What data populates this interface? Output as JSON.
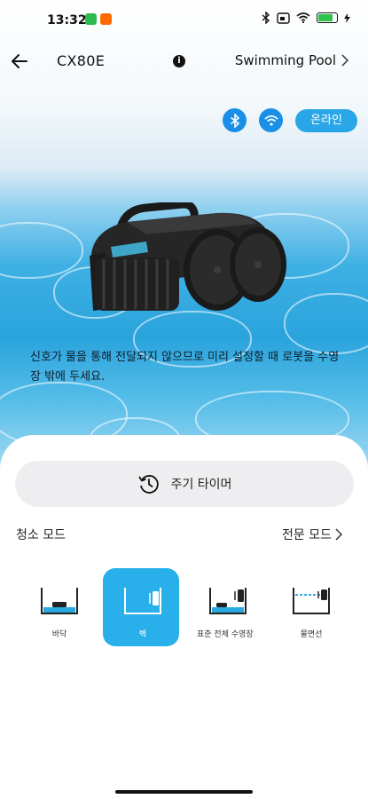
{
  "status_bar": {
    "time": "13:32",
    "battery_percent": 85
  },
  "header": {
    "device_name": "CX80E",
    "pool_link": "Swimming Pool"
  },
  "connection": {
    "online_label": "온라인",
    "accent": "#29a6e8"
  },
  "notice": "신호가 물을 통해 전달되지 않으므로 미리 설정할 때 로봇을 수영장 밖에 두세요.",
  "timer": {
    "label": "주기 타이머"
  },
  "cleaning": {
    "title": "청소 모드",
    "expert_label": "전문 모드",
    "modes": [
      {
        "label": "바닥",
        "icon": "floor-icon",
        "active": false
      },
      {
        "label": "벽",
        "icon": "wall-icon",
        "active": true
      },
      {
        "label": "표준 전체 수영장",
        "icon": "full-pool-icon",
        "active": false
      },
      {
        "label": "물면선",
        "icon": "waterline-icon",
        "active": false
      }
    ]
  }
}
